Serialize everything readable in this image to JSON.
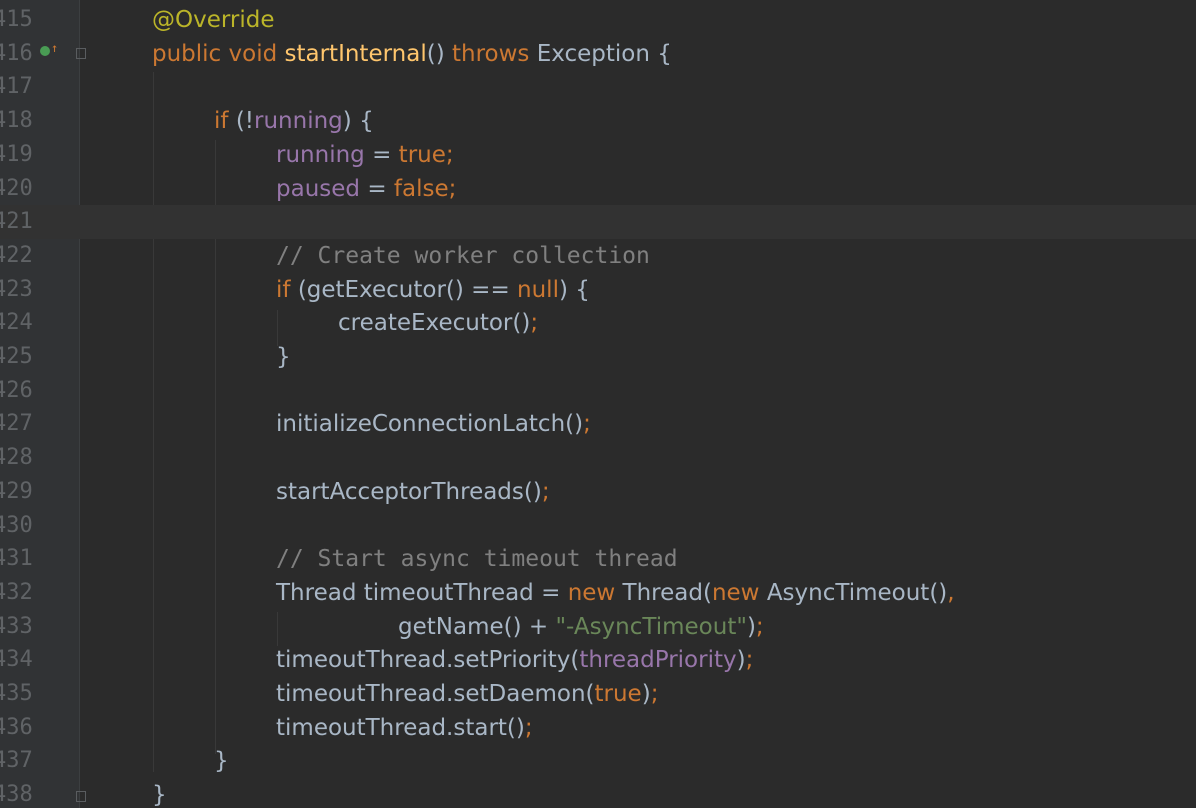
{
  "editor": {
    "lines": [
      {
        "no": "415",
        "segments": [
          [
            "ann",
            "@Override"
          ]
        ]
      },
      {
        "no": "416",
        "segments": [
          [
            "kw",
            "public void "
          ],
          [
            "fn",
            "startInternal"
          ],
          [
            "plain",
            "() "
          ],
          [
            "kw",
            "throws "
          ],
          [
            "plain",
            "Exception {"
          ]
        ]
      },
      {
        "no": "417",
        "segments": []
      },
      {
        "no": "418",
        "segments": [
          [
            "kw",
            "if "
          ],
          [
            "plain",
            "(!"
          ],
          [
            "fld",
            "running"
          ],
          [
            "plain",
            ") {"
          ]
        ]
      },
      {
        "no": "419",
        "segments": [
          [
            "fld",
            "running "
          ],
          [
            "plain",
            "= "
          ],
          [
            "kw",
            "true;"
          ]
        ]
      },
      {
        "no": "420",
        "segments": [
          [
            "fld",
            "paused "
          ],
          [
            "plain",
            "= "
          ],
          [
            "kw",
            "false;"
          ]
        ]
      },
      {
        "no": "421",
        "segments": []
      },
      {
        "no": "422",
        "segments": [
          [
            "cm",
            "// Create worker collection"
          ]
        ]
      },
      {
        "no": "423",
        "segments": [
          [
            "kw",
            "if "
          ],
          [
            "plain",
            "(getExecutor() == "
          ],
          [
            "kw",
            "null"
          ],
          [
            "plain",
            ") {"
          ]
        ]
      },
      {
        "no": "424",
        "segments": [
          [
            "plain",
            "createExecutor()"
          ],
          [
            "kw",
            ";"
          ]
        ]
      },
      {
        "no": "425",
        "segments": [
          [
            "plain",
            "}"
          ]
        ]
      },
      {
        "no": "426",
        "segments": []
      },
      {
        "no": "427",
        "segments": [
          [
            "plain",
            "initializeConnectionLatch()"
          ],
          [
            "kw",
            ";"
          ]
        ]
      },
      {
        "no": "428",
        "segments": []
      },
      {
        "no": "429",
        "segments": [
          [
            "plain",
            "startAcceptorThreads()"
          ],
          [
            "kw",
            ";"
          ]
        ]
      },
      {
        "no": "430",
        "segments": []
      },
      {
        "no": "431",
        "segments": [
          [
            "cm",
            "// Start async timeout thread"
          ]
        ]
      },
      {
        "no": "432",
        "segments": [
          [
            "plain",
            "Thread timeoutThread = "
          ],
          [
            "kw",
            "new "
          ],
          [
            "plain",
            "Thread("
          ],
          [
            "kw",
            "new "
          ],
          [
            "plain",
            "AsyncTimeout()"
          ],
          [
            "kw",
            ","
          ]
        ]
      },
      {
        "no": "433",
        "segments": [
          [
            "plain",
            "getName() + "
          ],
          [
            "str",
            "\"-AsyncTimeout\""
          ],
          [
            "plain",
            ")"
          ],
          [
            "kw",
            ";"
          ]
        ]
      },
      {
        "no": "434",
        "segments": [
          [
            "plain",
            "timeoutThread.setPriority("
          ],
          [
            "fld",
            "threadPriority"
          ],
          [
            "plain",
            ")"
          ],
          [
            "kw",
            ";"
          ]
        ]
      },
      {
        "no": "435",
        "segments": [
          [
            "plain",
            "timeoutThread.setDaemon("
          ],
          [
            "kw",
            "true"
          ],
          [
            "plain",
            ")"
          ],
          [
            "kw",
            ";"
          ]
        ]
      },
      {
        "no": "436",
        "segments": [
          [
            "plain",
            "timeoutThread.start()"
          ],
          [
            "kw",
            ";"
          ]
        ]
      },
      {
        "no": "437",
        "segments": [
          [
            "plain",
            "}"
          ]
        ]
      },
      {
        "no": "438",
        "segments": [
          [
            "plain",
            "}"
          ]
        ]
      }
    ],
    "current_line": "421",
    "override_marker_line": "416",
    "gutter_icons": [
      "override-marker-icon",
      "fold-start-icon",
      "fold-end-icon"
    ],
    "colors": {
      "background": "#2b2b2b",
      "gutter": "#313335",
      "keyword": "#cc7832",
      "annotation": "#bbb529",
      "method": "#ffc66d",
      "field": "#9876aa",
      "comment": "#808080",
      "string": "#6a8759",
      "text": "#a9b7c6"
    }
  }
}
